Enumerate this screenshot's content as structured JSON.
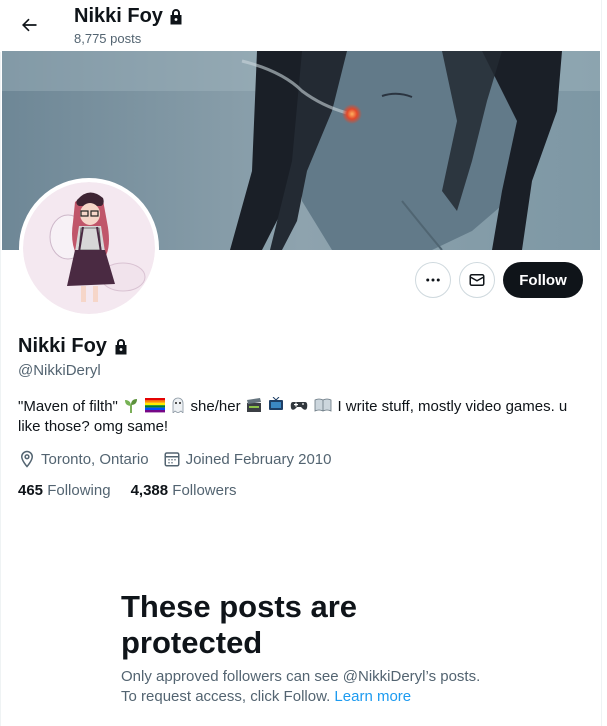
{
  "header": {
    "name": "Nikki Foy",
    "post_count": "8,775 posts",
    "back_icon": "arrow-left-icon",
    "lock_icon": "lock-icon"
  },
  "profile": {
    "display_name": "Nikki Foy",
    "handle": "@NikkiDeryl",
    "bio_part1": "\"Maven of filth\"",
    "bio_part2": "she/her",
    "bio_part3": "I write stuff, mostly video games. u like those? omg same!",
    "location": "Toronto, Ontario",
    "joined": "Joined February 2010",
    "following_count": "465",
    "following_label": "Following",
    "followers_count": "4,388",
    "followers_label": "Followers"
  },
  "actions": {
    "follow_label": "Follow",
    "more_icon": "more-dots-icon",
    "message_icon": "envelope-icon"
  },
  "protected": {
    "title": "These posts are protected",
    "description": "Only approved followers can see @NikkiDeryl’s posts. To request access, click Follow.",
    "learn_more": "Learn more"
  },
  "colors": {
    "accent": "#1d9bf0",
    "text_primary": "#0f1419",
    "text_secondary": "#536471",
    "follow_bg": "#0f1419"
  }
}
